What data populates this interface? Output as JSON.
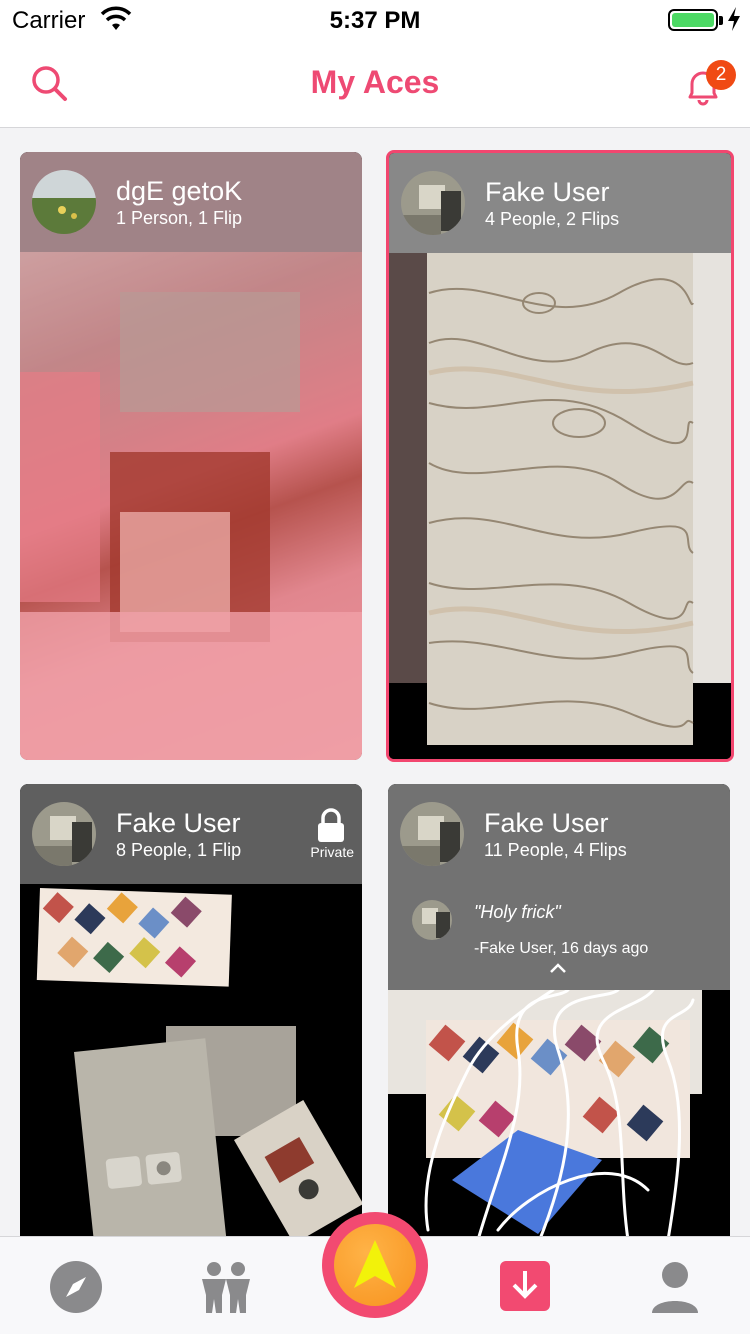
{
  "status_bar": {
    "carrier": "Carrier",
    "time": "5:37 PM",
    "battery_level": 1.0
  },
  "navbar": {
    "title": "My Aces",
    "notification_count": "2",
    "accent_color": "#ee4a73"
  },
  "cards": [
    {
      "name": "dgE getoK",
      "subtitle": "1 Person, 1 Flip",
      "selected": false
    },
    {
      "name": "Fake User",
      "subtitle": "4 People, 2 Flips",
      "selected": true
    },
    {
      "name": "Fake User",
      "subtitle": "8 People, 1 Flip",
      "private_label": "Private"
    },
    {
      "name": "Fake User",
      "subtitle": "11 People, 4 Flips",
      "quote": "\"Holy frick\"",
      "quote_author": "-Fake User, 16 days ago"
    }
  ],
  "tabbar": {
    "items": [
      "compass-icon",
      "people-icon",
      "ace-create-button",
      "download-icon",
      "profile-icon"
    ],
    "active_color": "#f24a71"
  }
}
